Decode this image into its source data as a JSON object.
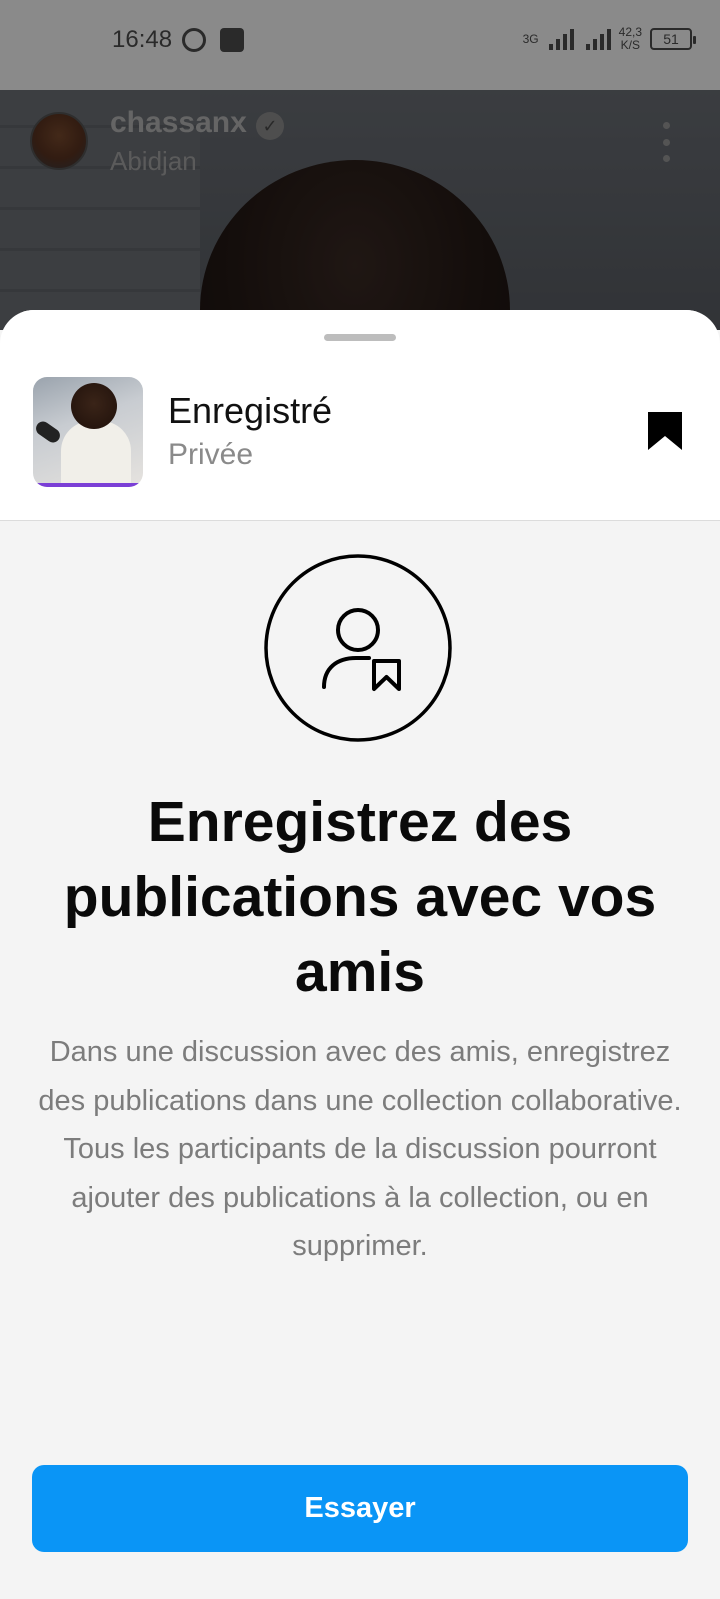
{
  "status_bar": {
    "time": "16:48",
    "network_label": "3G",
    "speed_value": "42,3",
    "speed_unit": "K/S",
    "battery": "51"
  },
  "post": {
    "username": "chassanx",
    "location": "Abidjan"
  },
  "collection": {
    "title": "Enregistré",
    "subtitle": "Privée"
  },
  "promo": {
    "headline": "Enregistrez des publications avec vos amis",
    "description": "Dans une discussion avec des amis, enregistrez des publications dans une collection collaborative. Tous les participants de la discussion pourront ajouter des publications à la collection, ou en supprimer."
  },
  "cta": {
    "label": "Essayer",
    "color": "#0a95f6"
  },
  "icons": {
    "status": [
      "whatsapp-icon",
      "app-notification-icon",
      "signal-icon",
      "battery-icon"
    ],
    "header": [
      "verified-badge-icon",
      "more-options-icon"
    ],
    "sheet": [
      "bookmark-filled-icon",
      "person-bookmark-icon"
    ]
  }
}
